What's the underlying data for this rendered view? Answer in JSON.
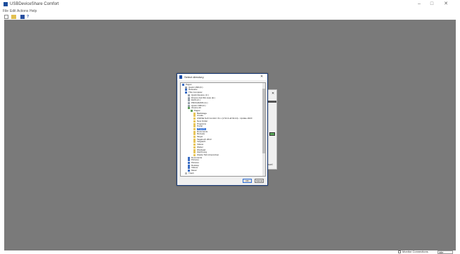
{
  "app": {
    "title": "USBDeviceShare Comfort",
    "window_controls": [
      "–",
      "□",
      "✕"
    ]
  },
  "menu": [
    "File",
    "Edit",
    "Actions",
    "Help"
  ],
  "toolbar": {
    "help_label": "?"
  },
  "status": {
    "checkbox_label": "Monitor Connections",
    "field": "Idle"
  },
  "dialog": {
    "title": "Select directory",
    "close": "✕",
    "ok_label": "OK",
    "cancel_label": "Cancel",
    "tree": [
      {
        "label": "Pages",
        "icon": "blue"
      },
      {
        "label": "Quick USB (D:)",
        "icon": "drive"
      },
      {
        "label": "Networks",
        "icon": "blue"
      },
      {
        "label": "This Computer",
        "icon": "blue"
      },
      {
        "label": "Quick Restore (C:)",
        "icon": "drive"
      },
      {
        "label": "Drivers 2nd Win Auto (E:)",
        "icon": "drive"
      },
      {
        "label": "DATA (F:)",
        "icon": "drive"
      },
      {
        "label": "PROGRAMS (G:)",
        "icon": "drive"
      },
      {
        "label": "Quick USB (D:)",
        "icon": "drive"
      },
      {
        "label": "Ubuntu 20",
        "icon": "green"
      },
      {
        "label": "Pages",
        "icon": "green"
      },
      {
        "label": "Backstage",
        "icon": "folder"
      },
      {
        "label": "Create",
        "icon": "folder"
      },
      {
        "label": "USDSE Soft Comfort V1.x (1.52 & all 64-bit) - Update 2020",
        "icon": "folder"
      },
      {
        "label": "New Folder",
        "icon": "folder"
      },
      {
        "label": "Programs",
        "icon": "folder"
      },
      {
        "label": "Portal",
        "icon": "folder"
      },
      {
        "label": "Projects",
        "icon": "folder",
        "selected": true
      },
      {
        "label": "Documents",
        "icon": "folder"
      },
      {
        "label": "Rezepte",
        "icon": "folder"
      },
      {
        "label": "Skype",
        "icon": "folder"
      },
      {
        "label": "Tagebuch 2013",
        "icon": "folder"
      },
      {
        "label": "Vergleich",
        "icon": "folder"
      },
      {
        "label": "Videos",
        "icon": "folder"
      },
      {
        "label": "Wetter",
        "icon": "folder"
      },
      {
        "label": "Wordpad",
        "icon": "folder"
      },
      {
        "label": "Zeichnung",
        "icon": "folder"
      },
      {
        "label": "Zweite Tab Unterordner",
        "icon": "folder"
      },
      {
        "label": "Documents",
        "icon": "blue"
      },
      {
        "label": "Pictures",
        "icon": "blue"
      },
      {
        "label": "Pictures",
        "icon": "blue"
      },
      {
        "label": "Desktop",
        "icon": "blue"
      },
      {
        "label": "Videos",
        "icon": "blue"
      },
      {
        "label": "Music",
        "icon": "blue"
      },
      {
        "label": "Trash",
        "icon": "gray"
      }
    ]
  },
  "bg_dialog": {
    "close": "✕",
    "cancel_label": "Cancel"
  }
}
